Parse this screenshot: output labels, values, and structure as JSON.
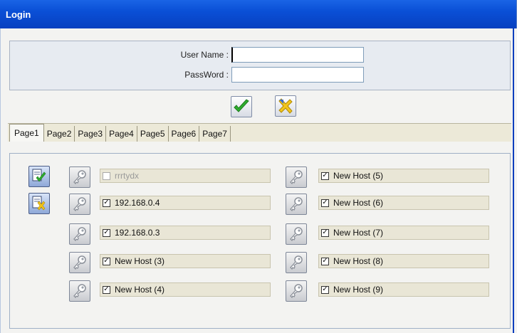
{
  "window": {
    "title": "Login"
  },
  "login": {
    "username_label": "User Name :",
    "username_value": "",
    "password_label": "PassWord :",
    "password_value": ""
  },
  "tabs": [
    "Page1",
    "Page2",
    "Page3",
    "Page4",
    "Page5",
    "Page6",
    "Page7"
  ],
  "active_tab": "Page1",
  "hosts_left": [
    {
      "label": "rrrtydx",
      "checked": false,
      "disabled": true
    },
    {
      "label": "192.168.0.4",
      "checked": true,
      "disabled": false
    },
    {
      "label": "192.168.0.3",
      "checked": true,
      "disabled": false
    },
    {
      "label": "New Host (3)",
      "checked": true,
      "disabled": false
    },
    {
      "label": "New Host (4)",
      "checked": true,
      "disabled": false
    }
  ],
  "hosts_right": [
    {
      "label": "New Host (5)",
      "checked": true,
      "disabled": false
    },
    {
      "label": "New Host (6)",
      "checked": true,
      "disabled": false
    },
    {
      "label": "New Host (7)",
      "checked": true,
      "disabled": false
    },
    {
      "label": "New Host (8)",
      "checked": true,
      "disabled": false
    },
    {
      "label": "New Host (9)",
      "checked": true,
      "disabled": false
    }
  ],
  "icons": {
    "confirm": "check-icon",
    "cancel": "cancel-x-icon",
    "select_all": "select-all-icon",
    "deselect_all": "deselect-all-icon",
    "host_key": "key-icon"
  },
  "colors": {
    "titlebar": "#0a4fd6",
    "confirm_green": "#2fae2f",
    "cancel_yellow": "#f2c51a"
  }
}
